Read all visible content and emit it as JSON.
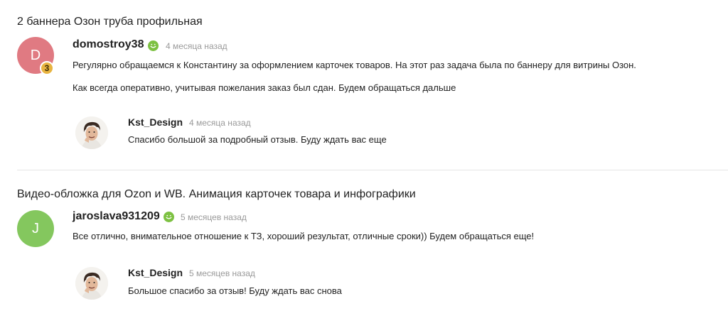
{
  "reviews": [
    {
      "title": "2 баннера Озон труба профильная",
      "user": {
        "initial": "D",
        "avatar_color": "#e07a82",
        "name": "domostroy38",
        "level_badge": "3"
      },
      "time": "4 месяца назад",
      "lines": [
        "Регулярно обращаемся к Константину за оформлением карточек товаров. На этот раз задача была по баннеру для витрины Озон.",
        "Как всегда оперативно, учитывая пожелания заказ был сдан. Будем обращаться дальше"
      ],
      "reply": {
        "name": "Kst_Design",
        "time": "4 месяца назад",
        "text": "Спасибо большой за подробный отзыв. Буду ждать вас еще"
      }
    },
    {
      "title": "Видео-обложка для Ozon и WB. Анимация карточек товара и инфографики",
      "user": {
        "initial": "J",
        "avatar_color": "#84c75e",
        "name": "jaroslava931209"
      },
      "time": "5 месяцев назад",
      "lines": [
        "Все отлично, внимательное отношение к ТЗ, хороший результат, отличные сроки)) Будем обращаться еще!"
      ],
      "reply": {
        "name": "Kst_Design",
        "time": "5 месяцев назад",
        "text": "Большое спасибо за отзыв! Буду ждать вас снова"
      }
    }
  ],
  "colors": {
    "online": "#7dc142",
    "badge": "#e8b440",
    "muted": "#9a9a9a",
    "divider": "#e5e5e5"
  },
  "icons": {
    "online_indicator": "online-dot-icon",
    "level_badge": "medal-icon"
  }
}
